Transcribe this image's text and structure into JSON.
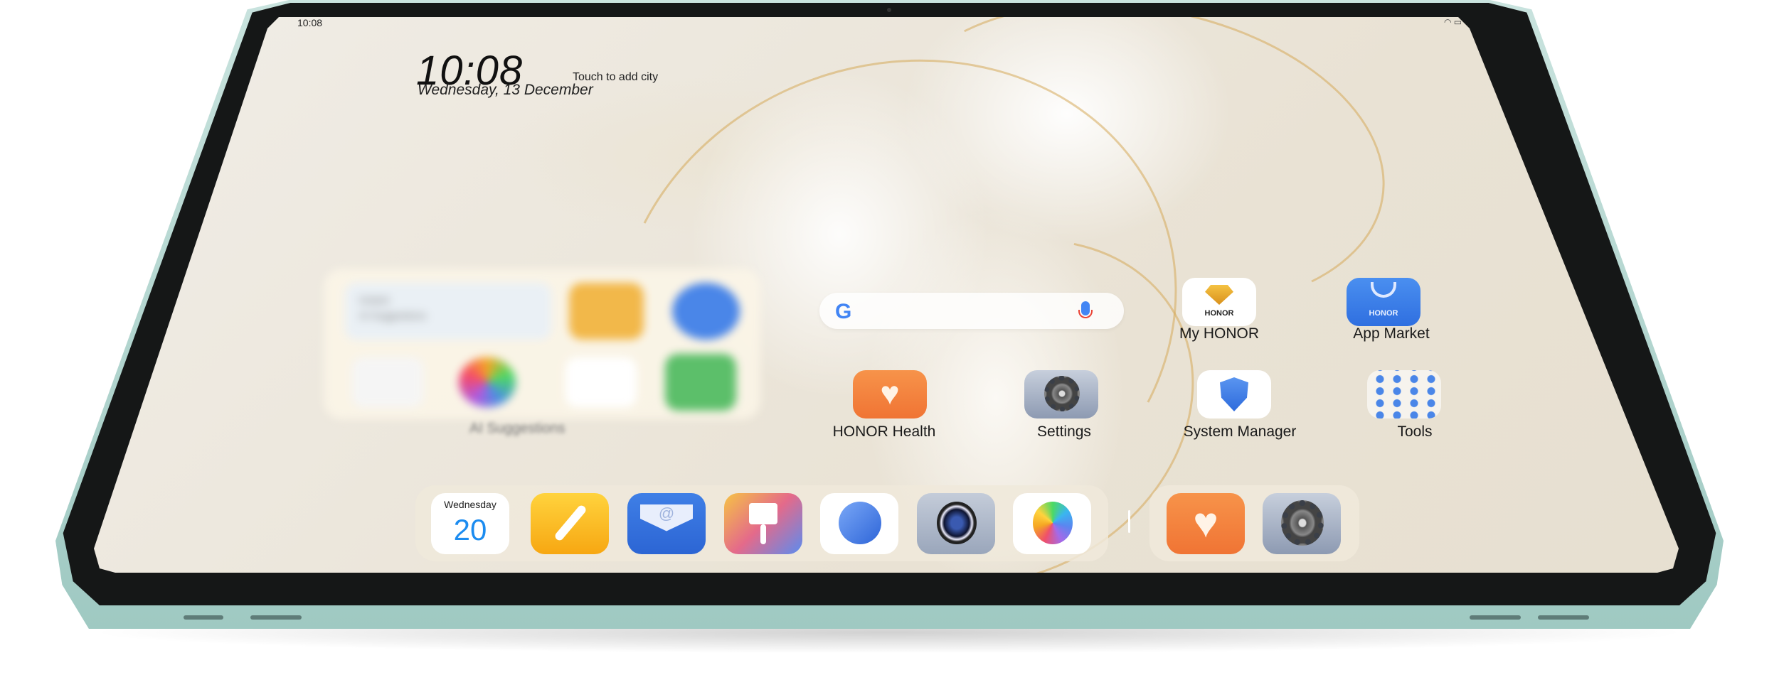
{
  "status_bar": {
    "time": "10:08",
    "indicators": "wifi battery"
  },
  "clock_widget": {
    "time": "10:08",
    "city_prompt": "Touch to add city",
    "date": "Wednesday, 13 December"
  },
  "search_widget": {
    "logo": "google-g-icon",
    "mic": "microphone-icon",
    "logo_text": "G"
  },
  "blurred_widget": {
    "title_line1": "Instant",
    "title_line2": "AI Suggestions",
    "label": "AI Suggestions"
  },
  "home_apps": [
    {
      "label": "My HONOR",
      "icon": "diamond-icon",
      "icon_text": "HONOR"
    },
    {
      "label": "App Market",
      "icon": "shopping-bag-icon",
      "icon_text": "HONOR"
    },
    {
      "label": "HONOR Health",
      "icon": "heart-icon"
    },
    {
      "label": "Settings",
      "icon": "gear-icon"
    },
    {
      "label": "System Manager",
      "icon": "shield-icon"
    },
    {
      "label": "Tools",
      "icon": "folder-icon"
    }
  ],
  "dock": {
    "calendar": {
      "weekday": "Wednesday",
      "day": "20"
    },
    "apps": [
      "Calendar",
      "Notes",
      "Email",
      "Themes",
      "Browser",
      "Camera",
      "Gallery"
    ],
    "recent": [
      "HONOR Health",
      "Settings"
    ]
  },
  "colors": {
    "accent_blue": "#3d7be8",
    "health_orange": "#f5803a",
    "frame_teal": "#a9d2cb"
  }
}
